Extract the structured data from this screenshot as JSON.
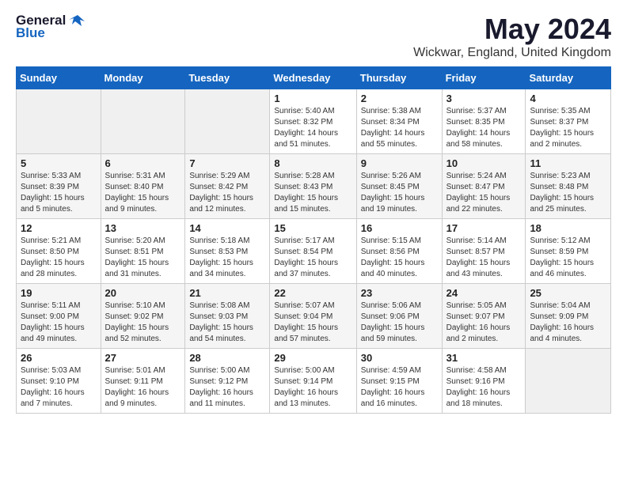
{
  "logo": {
    "general": "General",
    "blue": "Blue"
  },
  "title": "May 2024",
  "subtitle": "Wickwar, England, United Kingdom",
  "days_of_week": [
    "Sunday",
    "Monday",
    "Tuesday",
    "Wednesday",
    "Thursday",
    "Friday",
    "Saturday"
  ],
  "weeks": [
    [
      {
        "day": "",
        "info": ""
      },
      {
        "day": "",
        "info": ""
      },
      {
        "day": "",
        "info": ""
      },
      {
        "day": "1",
        "info": "Sunrise: 5:40 AM\nSunset: 8:32 PM\nDaylight: 14 hours\nand 51 minutes."
      },
      {
        "day": "2",
        "info": "Sunrise: 5:38 AM\nSunset: 8:34 PM\nDaylight: 14 hours\nand 55 minutes."
      },
      {
        "day": "3",
        "info": "Sunrise: 5:37 AM\nSunset: 8:35 PM\nDaylight: 14 hours\nand 58 minutes."
      },
      {
        "day": "4",
        "info": "Sunrise: 5:35 AM\nSunset: 8:37 PM\nDaylight: 15 hours\nand 2 minutes."
      }
    ],
    [
      {
        "day": "5",
        "info": "Sunrise: 5:33 AM\nSunset: 8:39 PM\nDaylight: 15 hours\nand 5 minutes."
      },
      {
        "day": "6",
        "info": "Sunrise: 5:31 AM\nSunset: 8:40 PM\nDaylight: 15 hours\nand 9 minutes."
      },
      {
        "day": "7",
        "info": "Sunrise: 5:29 AM\nSunset: 8:42 PM\nDaylight: 15 hours\nand 12 minutes."
      },
      {
        "day": "8",
        "info": "Sunrise: 5:28 AM\nSunset: 8:43 PM\nDaylight: 15 hours\nand 15 minutes."
      },
      {
        "day": "9",
        "info": "Sunrise: 5:26 AM\nSunset: 8:45 PM\nDaylight: 15 hours\nand 19 minutes."
      },
      {
        "day": "10",
        "info": "Sunrise: 5:24 AM\nSunset: 8:47 PM\nDaylight: 15 hours\nand 22 minutes."
      },
      {
        "day": "11",
        "info": "Sunrise: 5:23 AM\nSunset: 8:48 PM\nDaylight: 15 hours\nand 25 minutes."
      }
    ],
    [
      {
        "day": "12",
        "info": "Sunrise: 5:21 AM\nSunset: 8:50 PM\nDaylight: 15 hours\nand 28 minutes."
      },
      {
        "day": "13",
        "info": "Sunrise: 5:20 AM\nSunset: 8:51 PM\nDaylight: 15 hours\nand 31 minutes."
      },
      {
        "day": "14",
        "info": "Sunrise: 5:18 AM\nSunset: 8:53 PM\nDaylight: 15 hours\nand 34 minutes."
      },
      {
        "day": "15",
        "info": "Sunrise: 5:17 AM\nSunset: 8:54 PM\nDaylight: 15 hours\nand 37 minutes."
      },
      {
        "day": "16",
        "info": "Sunrise: 5:15 AM\nSunset: 8:56 PM\nDaylight: 15 hours\nand 40 minutes."
      },
      {
        "day": "17",
        "info": "Sunrise: 5:14 AM\nSunset: 8:57 PM\nDaylight: 15 hours\nand 43 minutes."
      },
      {
        "day": "18",
        "info": "Sunrise: 5:12 AM\nSunset: 8:59 PM\nDaylight: 15 hours\nand 46 minutes."
      }
    ],
    [
      {
        "day": "19",
        "info": "Sunrise: 5:11 AM\nSunset: 9:00 PM\nDaylight: 15 hours\nand 49 minutes."
      },
      {
        "day": "20",
        "info": "Sunrise: 5:10 AM\nSunset: 9:02 PM\nDaylight: 15 hours\nand 52 minutes."
      },
      {
        "day": "21",
        "info": "Sunrise: 5:08 AM\nSunset: 9:03 PM\nDaylight: 15 hours\nand 54 minutes."
      },
      {
        "day": "22",
        "info": "Sunrise: 5:07 AM\nSunset: 9:04 PM\nDaylight: 15 hours\nand 57 minutes."
      },
      {
        "day": "23",
        "info": "Sunrise: 5:06 AM\nSunset: 9:06 PM\nDaylight: 15 hours\nand 59 minutes."
      },
      {
        "day": "24",
        "info": "Sunrise: 5:05 AM\nSunset: 9:07 PM\nDaylight: 16 hours\nand 2 minutes."
      },
      {
        "day": "25",
        "info": "Sunrise: 5:04 AM\nSunset: 9:09 PM\nDaylight: 16 hours\nand 4 minutes."
      }
    ],
    [
      {
        "day": "26",
        "info": "Sunrise: 5:03 AM\nSunset: 9:10 PM\nDaylight: 16 hours\nand 7 minutes."
      },
      {
        "day": "27",
        "info": "Sunrise: 5:01 AM\nSunset: 9:11 PM\nDaylight: 16 hours\nand 9 minutes."
      },
      {
        "day": "28",
        "info": "Sunrise: 5:00 AM\nSunset: 9:12 PM\nDaylight: 16 hours\nand 11 minutes."
      },
      {
        "day": "29",
        "info": "Sunrise: 5:00 AM\nSunset: 9:14 PM\nDaylight: 16 hours\nand 13 minutes."
      },
      {
        "day": "30",
        "info": "Sunrise: 4:59 AM\nSunset: 9:15 PM\nDaylight: 16 hours\nand 16 minutes."
      },
      {
        "day": "31",
        "info": "Sunrise: 4:58 AM\nSunset: 9:16 PM\nDaylight: 16 hours\nand 18 minutes."
      },
      {
        "day": "",
        "info": ""
      }
    ]
  ]
}
